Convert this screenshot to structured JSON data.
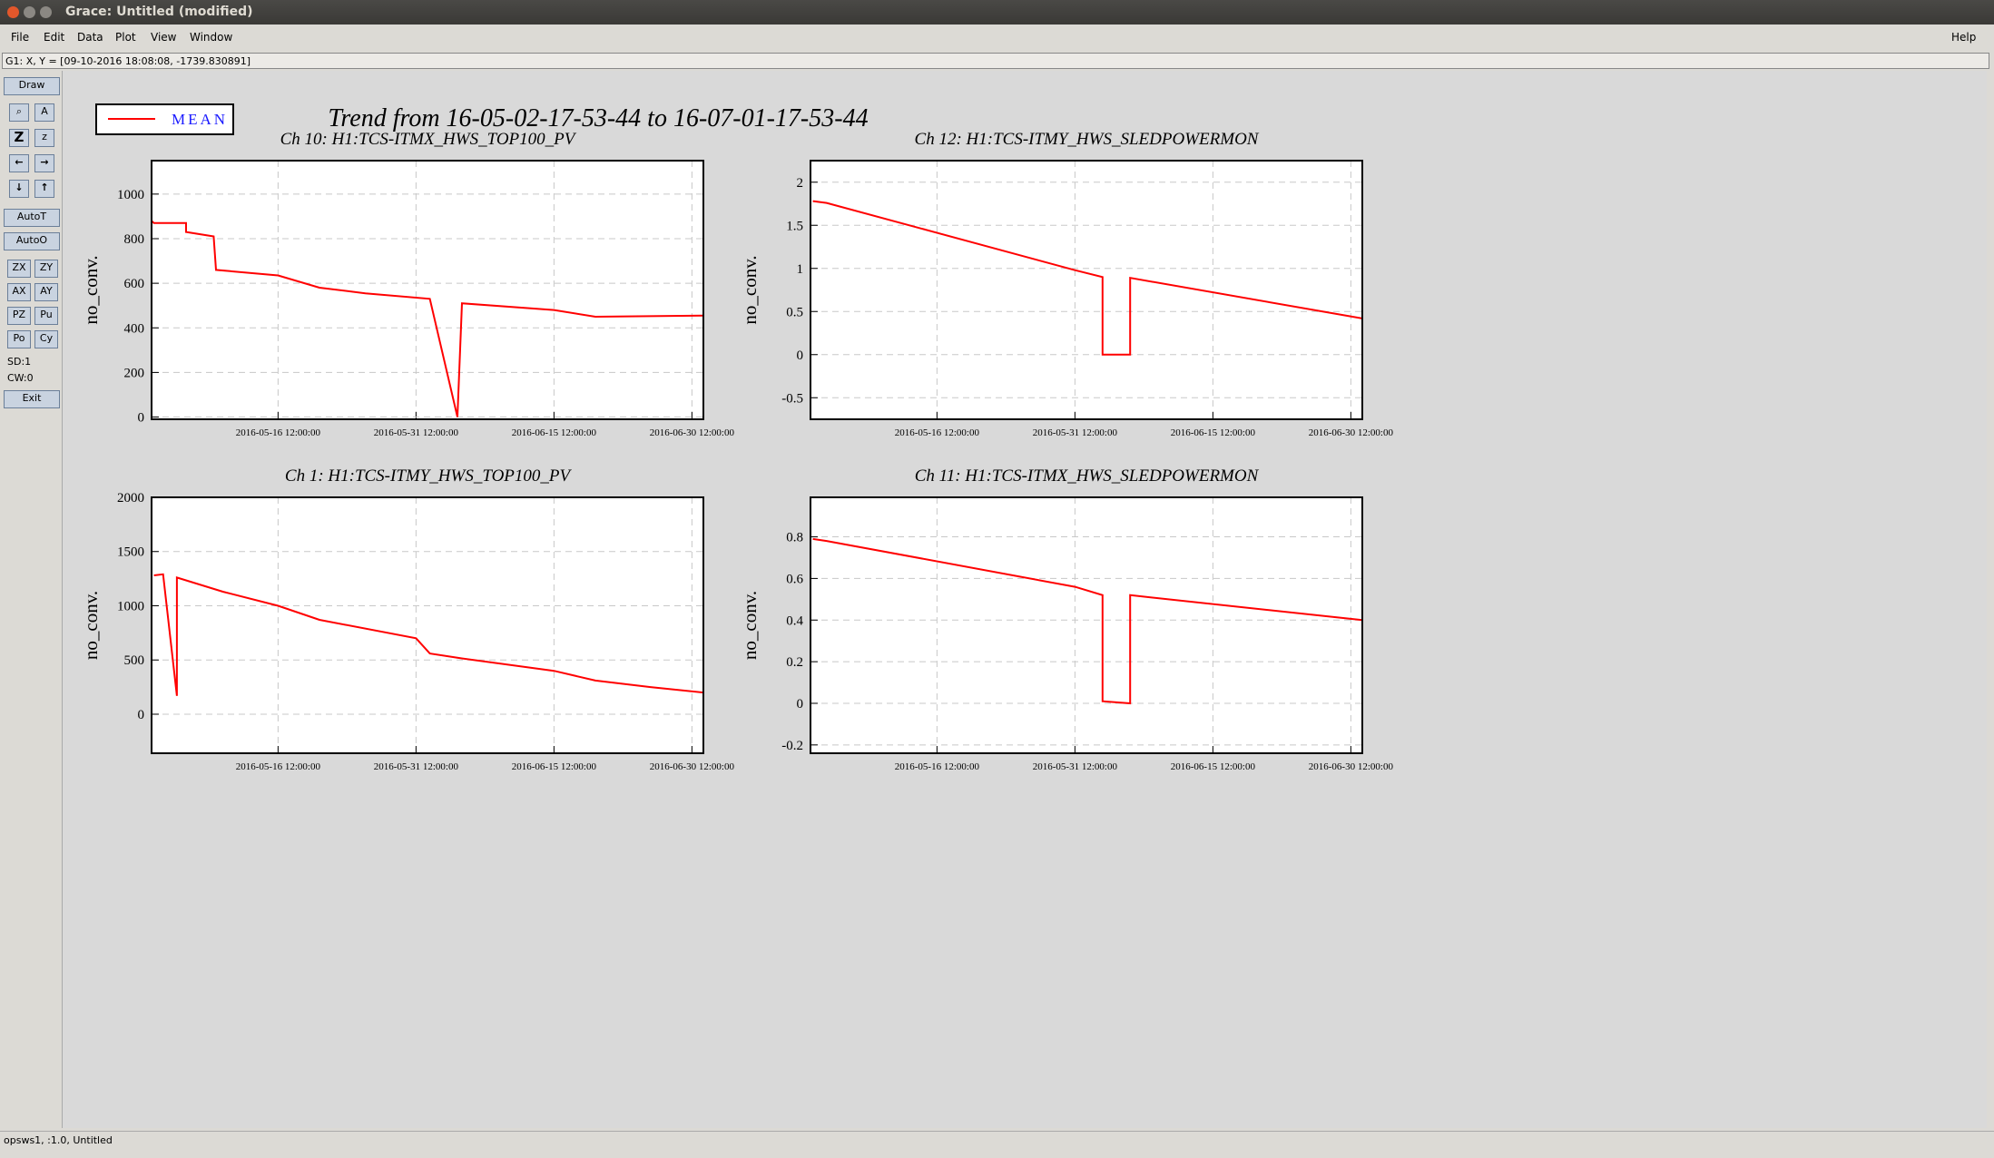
{
  "window": {
    "title": "Grace: Untitled (modified)"
  },
  "menu": {
    "file": "File",
    "edit": "Edit",
    "data": "Data",
    "plot": "Plot",
    "view": "View",
    "window": "Window",
    "help": "Help"
  },
  "locator": "G1: X, Y = [09-10-2016 18:08:08, -1739.830891]",
  "toolbar": {
    "draw": "Draw",
    "autot": "AutoT",
    "autoo": "AutoO",
    "zx": "ZX",
    "zy": "ZY",
    "ax": "AX",
    "ay": "AY",
    "pz": "PZ",
    "pu": "Pu",
    "po": "Po",
    "cy": "Cy",
    "sd": "SD:1",
    "cw": "CW:0",
    "exit": "Exit"
  },
  "status": "opsws1, :1.0, Untitled",
  "legend": {
    "label": "MEAN",
    "color": "#ff0000"
  },
  "main_title": "Trend from 16-05-02-17-53-44 to 16-07-01-17-53-44",
  "colors": {
    "series": "#ff0000",
    "plot_bg": "#ffffff",
    "canvas_bg": "#d9d9d9",
    "grid": "#c0c0c0"
  },
  "chart_data": [
    {
      "type": "line",
      "title": "Ch 10: H1:TCS-ITMX_HWS_TOP100_PV",
      "ylabel": "no_conv.",
      "xlabel": "",
      "xticks": [
        "2016-05-16 12:00:00",
        "2016-05-31 12:00:00",
        "2016-06-15 12:00:00",
        "2016-06-30 12:00:00"
      ],
      "yticks": [
        "0",
        "200",
        "400",
        "600",
        "800",
        "1000"
      ],
      "ylim": [
        -10,
        1150
      ],
      "x": [
        "2016-05-02 17:53",
        "2016-05-03 00:00",
        "2016-05-06 12:00",
        "2016-05-06 12:00",
        "2016-05-09 12:00",
        "2016-05-09 18:00",
        "2016-05-16 12:00",
        "2016-05-21 00:00",
        "2016-05-26 00:00",
        "2016-06-02 00:00",
        "2016-06-05 00:00",
        "2016-06-05 12:00",
        "2016-06-15 12:00",
        "2016-06-20 00:00",
        "2016-07-01 17:53"
      ],
      "values": [
        880,
        870,
        870,
        830,
        810,
        660,
        635,
        580,
        555,
        530,
        0,
        510,
        480,
        450,
        455
      ],
      "series_name": "MEAN"
    },
    {
      "type": "line",
      "title": "Ch 12: H1:TCS-ITMY_HWS_SLEDPOWERMON",
      "ylabel": "no_conv.",
      "xlabel": "",
      "xticks": [
        "2016-05-16 12:00:00",
        "2016-05-31 12:00:00",
        "2016-06-15 12:00:00",
        "2016-06-30 12:00:00"
      ],
      "yticks": [
        "-0.5",
        "0",
        "0.5",
        "1",
        "1.5",
        "2"
      ],
      "ylim": [
        -0.75,
        2.25
      ],
      "x": [
        "2016-05-03 00:00",
        "2016-05-04 12:00",
        "2016-05-31 12:00",
        "2016-06-03 12:00",
        "2016-06-03 12:00",
        "2016-06-06 12:00",
        "2016-06-06 12:00",
        "2016-07-01 17:53"
      ],
      "values": [
        1.78,
        1.76,
        0.98,
        0.9,
        0.0,
        0.0,
        0.89,
        0.42
      ],
      "series_name": "MEAN"
    },
    {
      "type": "line",
      "title": "Ch 1: H1:TCS-ITMY_HWS_TOP100_PV",
      "ylabel": "no_conv.",
      "xlabel": "",
      "xticks": [
        "2016-05-16 12:00:00",
        "2016-05-31 12:00:00",
        "2016-06-15 12:00:00",
        "2016-06-30 12:00:00"
      ],
      "yticks": [
        "0",
        "500",
        "1000",
        "1500",
        "2000"
      ],
      "ylim": [
        -360,
        2000
      ],
      "x": [
        "2016-05-03 00:00",
        "2016-05-04 00:00",
        "2016-05-05 12:00",
        "2016-05-05 12:00",
        "2016-05-10 12:00",
        "2016-05-16 12:00",
        "2016-05-21 00:00",
        "2016-05-31 12:00",
        "2016-06-02 00:00",
        "2016-06-05 00:00",
        "2016-06-15 12:00",
        "2016-06-20 00:00",
        "2016-06-26 00:00",
        "2016-07-01 17:53"
      ],
      "values": [
        1280,
        1290,
        170,
        1260,
        1130,
        1000,
        870,
        700,
        560,
        520,
        400,
        310,
        250,
        200
      ],
      "series_name": "MEAN"
    },
    {
      "type": "line",
      "title": "Ch 11: H1:TCS-ITMX_HWS_SLEDPOWERMON",
      "ylabel": "no_conv.",
      "xlabel": "",
      "xticks": [
        "2016-05-16 12:00:00",
        "2016-05-31 12:00:00",
        "2016-06-15 12:00:00",
        "2016-06-30 12:00:00"
      ],
      "yticks": [
        "-0.2",
        "0",
        "0.2",
        "0.4",
        "0.6",
        "0.8"
      ],
      "ylim": [
        -0.24,
        0.99
      ],
      "x": [
        "2016-05-03 00:00",
        "2016-05-04 12:00",
        "2016-05-31 12:00",
        "2016-06-03 12:00",
        "2016-06-03 12:00",
        "2016-06-06 12:00",
        "2016-06-06 12:00",
        "2016-07-01 17:53"
      ],
      "values": [
        0.79,
        0.78,
        0.56,
        0.52,
        0.01,
        0.0,
        0.52,
        0.4
      ],
      "series_name": "MEAN"
    }
  ]
}
